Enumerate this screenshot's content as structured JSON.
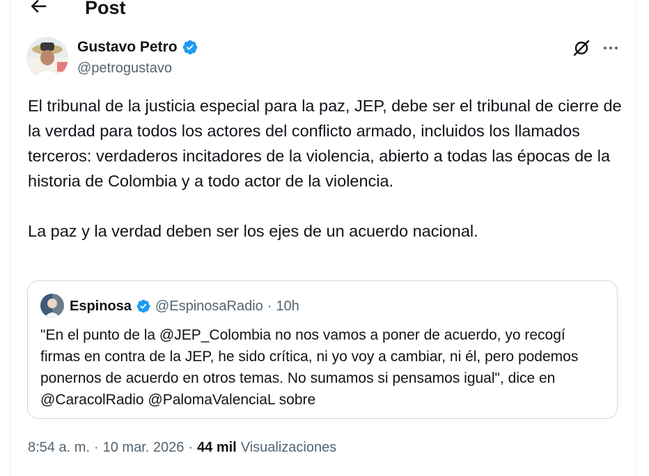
{
  "header": {
    "title": "Post"
  },
  "author": {
    "name": "Gustavo Petro",
    "handle": "@petrogustavo"
  },
  "tweet": {
    "paragraphs": [
      "El tribunal de la justicia especial para la paz, JEP, debe ser el tribunal de cierre de la verdad para todos los actores del conflicto armado, incluidos los llamados terceros: verdaderos incitadores de la violencia, abierto a todas las épocas de la historia de Colombia y a todo actor de la violencia.",
      "La paz y la verdad deben ser los ejes de un acuerdo nacional."
    ]
  },
  "quote": {
    "name": "Espinosa",
    "handle": "@EspinosaRadio",
    "separator": "·",
    "time": "10h",
    "text": "\"En el punto de la @JEP_Colombia no nos vamos a poner de acuerdo, yo recogí firmas en contra de la JEP, he sido crítica, ni yo voy a cambiar, ni él, pero podemos ponernos de acuerdo en otros temas. No sumamos si pensamos igual\", dice en @CaracolRadio @PalomaValenciaL sobre"
  },
  "meta": {
    "time": "8:54 a. m.",
    "sep1": "·",
    "date": "10 mar. 2026",
    "sep2": "·",
    "views_count": "44 mil",
    "views_label": "Visualizaciones"
  },
  "colors": {
    "verified": "#1d9bf0",
    "secondary": "#536471",
    "text": "#0f1419",
    "border": "#cfd9de"
  },
  "icons": {
    "back": "arrow-left-icon",
    "verified": "verified-badge-icon",
    "grok": "grok-icon",
    "more": "more-dots-icon"
  }
}
